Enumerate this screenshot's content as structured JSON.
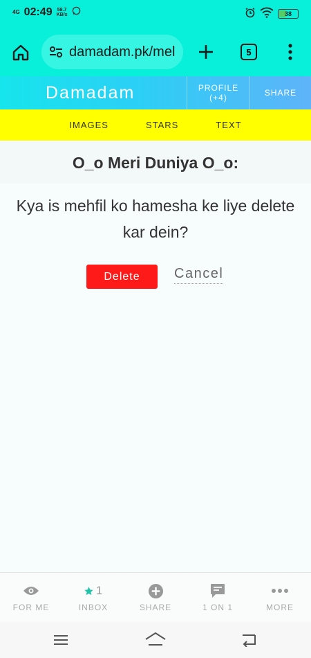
{
  "status": {
    "network": "4G",
    "time": "02:49",
    "speed_value": "58.7",
    "speed_unit": "KB/s",
    "battery": "38"
  },
  "browser": {
    "url": "damadam.pk/mel",
    "tab_count": "5"
  },
  "header": {
    "brand": "Damadam",
    "profile_label": "PROFILE",
    "profile_badge": "(+4)",
    "share_label": "SHARE"
  },
  "subnav": {
    "items": [
      "IMAGES",
      "STARS",
      "TEXT"
    ]
  },
  "page": {
    "title": "O_o Meri Duniya O_o:",
    "question": "Kya is mehfil ko hamesha ke liye delete kar dein?",
    "delete_label": "Delete",
    "cancel_label": "Cancel"
  },
  "bottom_nav": {
    "for_me": "FOR ME",
    "inbox_count": "1",
    "inbox": "INBOX",
    "share": "SHARE",
    "one_on_one": "1 ON 1",
    "more": "MORE"
  },
  "colors": {
    "browser_bg": "#08f0da",
    "subnav_bg": "#ffff00",
    "delete_bg": "#ff1a1a",
    "inbox_star": "#1fc4a8"
  }
}
